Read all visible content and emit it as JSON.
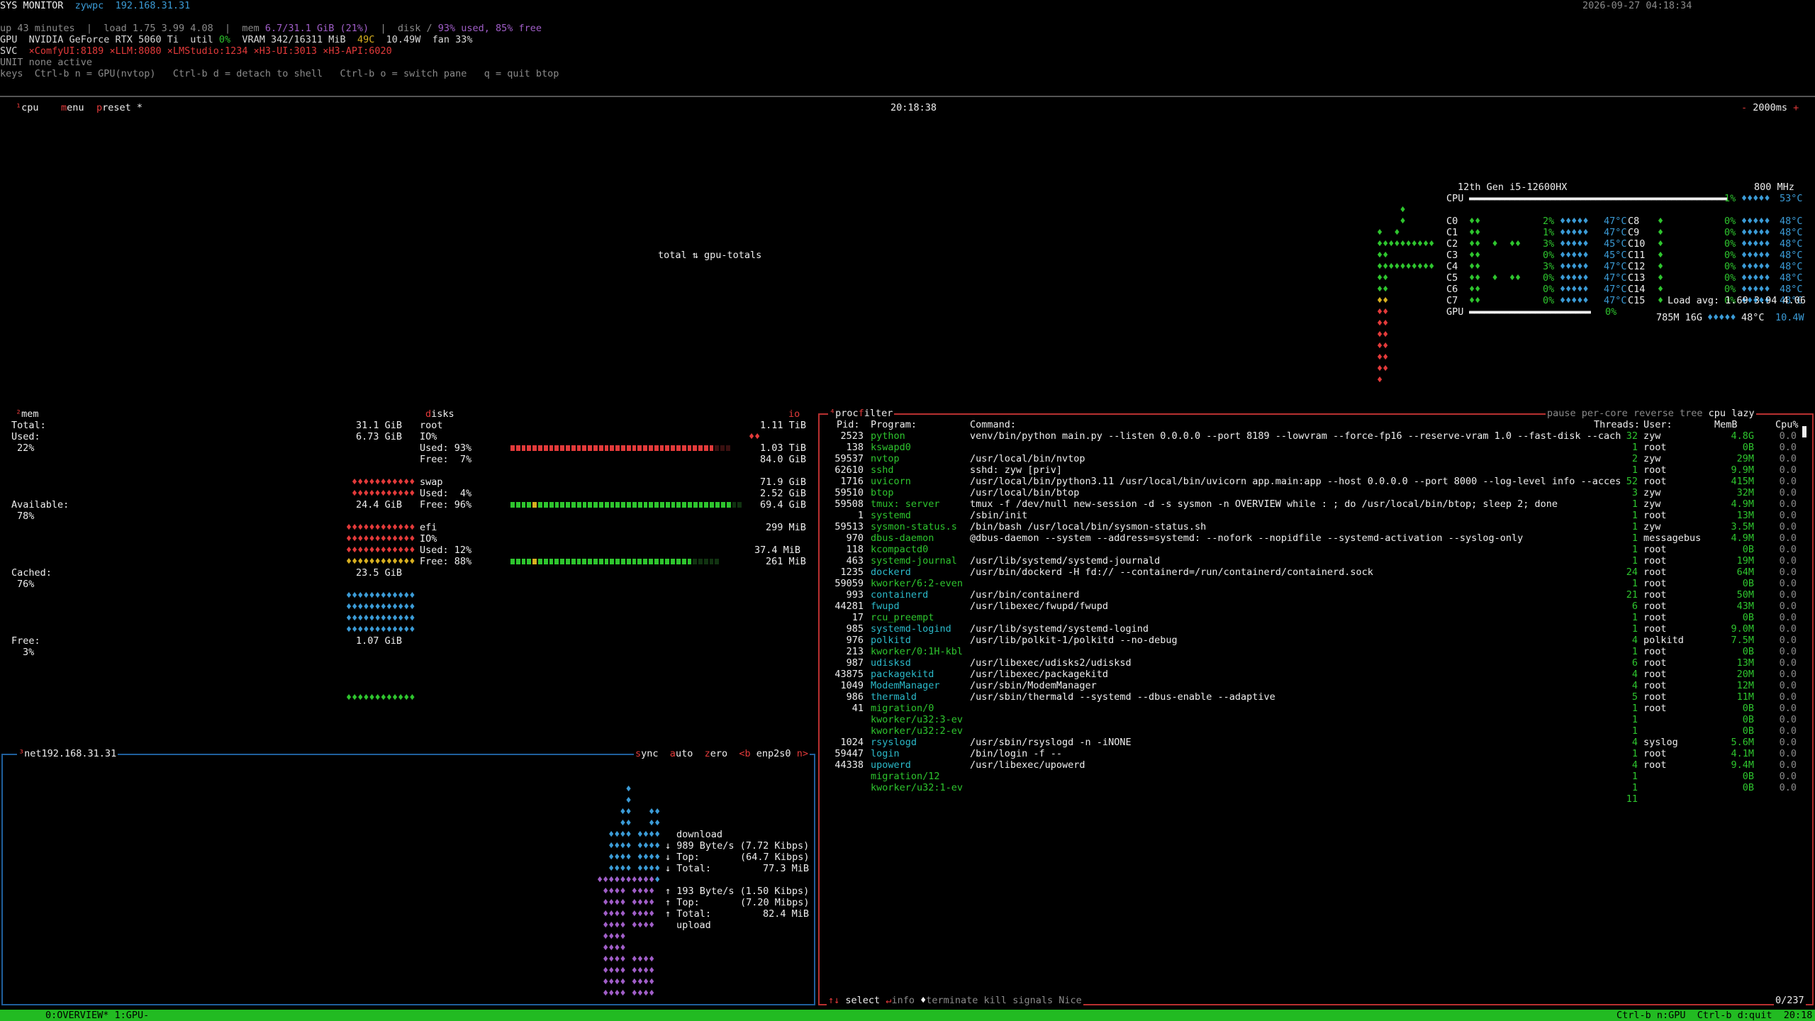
{
  "header": {
    "title": "SYS MONITOR",
    "host": "zywpc",
    "ip": "192.168.31.31",
    "datetime": "2026-09-27 04:18:34",
    "line2_a": "up 43 minutes  |  load 1.75 3.99 4.08  |  mem ",
    "line2_mem": "6.7/31.1 GiB (21%)",
    "line2_b": "  |  disk /",
    "line2_disk": " 93% used, 85% free",
    "gpu_label": "GPU  NVIDIA GeForce RTX 5060 Ti  util ",
    "gpu_util": "0%",
    "gpu_vram": "  VRAM 342/16311 MiB  ",
    "gpu_temp": "49C",
    "gpu_rest": "  10.49W  fan 33%",
    "svc_label": "SVC  ",
    "svc_items": [
      "×ComfyUI:8189 ",
      "×LLM:8080 ",
      "×LMStudio:1234 ",
      "×H3-UI:3013 ",
      "×H3-API:6020"
    ],
    "unit_line": "UNIT none active",
    "keys_line": "keys  Ctrl-b n = GPU(nvtop)   Ctrl-b d = detach to shell   Ctrl-b o = switch pane   q = quit btop"
  },
  "cpu_box": {
    "tab_num": "¹",
    "tab_label": "cpu",
    "menu_m": "m",
    "menu_label": "enu",
    "preset_p": "p",
    "preset_label": "reset *",
    "clock": "20:18:38",
    "interval_minus": "-",
    "interval": " 2000ms ",
    "interval_plus": "+",
    "graph_label": "total ⇅ gpu-totals",
    "cpu_model": "12th Gen i5-12600HX",
    "cpu_freq": "800 MHz",
    "cpu_total_label": "CPU",
    "cpu_total_pct": "1%",
    "cpu_total_temp": "53°C",
    "cores_left": [
      {
        "name": "C0",
        "pct": "2%",
        "temp": "47°C"
      },
      {
        "name": "C1",
        "pct": "1%",
        "temp": "47°C"
      },
      {
        "name": "C2",
        "pct": "3%",
        "temp": "45°C"
      },
      {
        "name": "C3",
        "pct": "0%",
        "temp": "45°C"
      },
      {
        "name": "C4",
        "pct": "3%",
        "temp": "47°C"
      },
      {
        "name": "C5",
        "pct": "0%",
        "temp": "47°C"
      },
      {
        "name": "C6",
        "pct": "0%",
        "temp": "47°C"
      },
      {
        "name": "C7",
        "pct": "0%",
        "temp": "47°C"
      }
    ],
    "cores_right": [
      {
        "name": "C8",
        "pct": "0%",
        "temp": "48°C"
      },
      {
        "name": "C9",
        "pct": "0%",
        "temp": "48°C"
      },
      {
        "name": "C10",
        "pct": "0%",
        "temp": "48°C"
      },
      {
        "name": "C11",
        "pct": "0%",
        "temp": "48°C"
      },
      {
        "name": "C12",
        "pct": "0%",
        "temp": "48°C"
      },
      {
        "name": "C13",
        "pct": "0%",
        "temp": "48°C"
      },
      {
        "name": "C14",
        "pct": "0%",
        "temp": "48°C"
      },
      {
        "name": "C15",
        "pct": "0%",
        "temp": "48°C"
      }
    ],
    "load_avg": "Load avg: 1.69 3.94 4.06",
    "gpu_label": "GPU",
    "gpu_pct": "0%",
    "gpu_mem": "785M 16G",
    "gpu_temp": "48°C",
    "gpu_watt": "10.4W"
  },
  "mem_box": {
    "tab_num": "²",
    "tab_label": "mem",
    "total_label": "Total:",
    "total_val": "31.1 GiB",
    "used_label": "Used:",
    "used_val": "6.73 GiB",
    "used_pct": "22%",
    "available_label": "Available:",
    "available_val": "24.4 GiB",
    "available_pct": "78%",
    "cached_label": "Cached:",
    "cached_val": "23.5 GiB",
    "cached_pct": "76%",
    "free_label": "Free:",
    "free_val": "1.07 GiB",
    "free_pct": "3%"
  },
  "disks": {
    "title_d": "d",
    "title_label": "isks",
    "io_label": "io",
    "root": {
      "name": "root",
      "total": "1.11 TiB",
      "io": "IO%",
      "used_label": "Used: 93%",
      "used_val": "1.03 TiB",
      "free_label": "Free:  7%",
      "free_val": "84.0 GiB",
      "used_frac": 0.93
    },
    "swap": {
      "name": "swap",
      "total": "71.9 GiB",
      "used_label": "Used:  4%",
      "used_val": "2.52 GiB",
      "free_label": "Free: 96%",
      "free_val": "69.4 GiB",
      "free_frac": 0.96
    },
    "efi": {
      "name": "efi",
      "total": "299 MiB",
      "io": "IO%",
      "used_label": "Used: 12%",
      "used_val": "37.4 MiB",
      "free_label": "Free: 88%",
      "free_val": "261 MiB",
      "free_frac": 0.88
    }
  },
  "net_box": {
    "tab_num": "³",
    "tab_label": "net",
    "ip": "192.168.31.31",
    "sync_s": "s",
    "sync_label": "ync",
    "auto_a": "a",
    "auto_label": "uto",
    "zero_z": "z",
    "zero_label": "ero",
    "iface_prev": "<b",
    "iface": " enp2s0 ",
    "iface_next": "n>",
    "download_label": "download",
    "dl_rate": "989 Byte/s (7.72 Kibps)",
    "dl_top_label": "Top:",
    "dl_top": "(64.7 Kibps)",
    "dl_total_label": "Total:",
    "dl_total": "77.3 MiB",
    "ul_rate": "193 Byte/s (1.50 Kibps)",
    "ul_top_label": "Top:",
    "ul_top": "(7.20 Mibps)",
    "ul_total_label": "Total:",
    "ul_total": "82.4 MiB",
    "upload_label": "upload"
  },
  "proc_box": {
    "tab_num": "⁴",
    "tab_label": "proc",
    "filter_f": "f",
    "filter_label": "ilter",
    "pause": "pause",
    "per_core": "per-core",
    "reverse": "reverse",
    "tree": "tree",
    "sort": "cpu lazy",
    "headers": {
      "pid": "Pid:",
      "program": "Program:",
      "command": "Command:",
      "threads": "Threads:",
      "user": "User:",
      "mem": "MemB",
      "cpu": "Cpu%"
    },
    "rows": [
      {
        "pid": "2523",
        "program": "python",
        "command": "venv/bin/python main.py --listen 0.0.0.0 --port 8189 --lowvram --force-fp16 --reserve-vram 1.0 --fast-disk --cach",
        "threads": "32",
        "user": "zyw",
        "mem": "4.8G",
        "cpu": "0.0"
      },
      {
        "pid": "138",
        "program": "kswapd0",
        "command": "",
        "threads": "1",
        "user": "root",
        "mem": "0B",
        "cpu": "0.0"
      },
      {
        "pid": "59537",
        "program": "nvtop",
        "command": "/usr/local/bin/nvtop",
        "threads": "2",
        "user": "zyw",
        "mem": "29M",
        "cpu": "0.0"
      },
      {
        "pid": "62610",
        "program": "sshd",
        "command": "sshd: zyw [priv]",
        "threads": "1",
        "user": "root",
        "mem": "9.9M",
        "cpu": "0.0"
      },
      {
        "pid": "1716",
        "program": "uvicorn",
        "command": "/usr/local/bin/python3.11 /usr/local/bin/uvicorn app.main:app --host 0.0.0.0 --port 8000 --log-level info --acces",
        "threads": "52",
        "user": "root",
        "mem": "415M",
        "cpu": "0.0"
      },
      {
        "pid": "59510",
        "program": "btop",
        "command": "/usr/local/bin/btop",
        "threads": "3",
        "user": "zyw",
        "mem": "32M",
        "cpu": "0.0"
      },
      {
        "pid": "59508",
        "program": "tmux: server",
        "command": "tmux -f /dev/null new-session -d -s sysmon -n OVERVIEW while : ; do /usr/local/bin/btop; sleep 2; done",
        "threads": "1",
        "user": "zyw",
        "mem": "4.9M",
        "cpu": "0.0"
      },
      {
        "pid": "1",
        "program": "systemd",
        "command": "/sbin/init",
        "threads": "1",
        "user": "root",
        "mem": "13M",
        "cpu": "0.0"
      },
      {
        "pid": "59513",
        "program": "sysmon-status.s",
        "command": "/bin/bash /usr/local/bin/sysmon-status.sh",
        "threads": "1",
        "user": "zyw",
        "mem": "3.5M",
        "cpu": "0.0"
      },
      {
        "pid": "970",
        "program": "dbus-daemon",
        "command": "@dbus-daemon --system --address=systemd: --nofork --nopidfile --systemd-activation --syslog-only",
        "threads": "1",
        "user": "messagebus",
        "mem": "4.9M",
        "cpu": "0.0"
      },
      {
        "pid": "118",
        "program": "kcompactd0",
        "command": "",
        "threads": "1",
        "user": "root",
        "mem": "0B",
        "cpu": "0.0"
      },
      {
        "pid": "463",
        "program": "systemd-journal",
        "command": "/usr/lib/systemd/systemd-journald",
        "threads": "1",
        "user": "root",
        "mem": "19M",
        "cpu": "0.0"
      },
      {
        "pid": "1235",
        "program": "dockerd",
        "command": "/usr/bin/dockerd -H fd:// --containerd=/run/containerd/containerd.sock",
        "threads": "24",
        "user": "root",
        "mem": "64M",
        "cpu": "0.0"
      },
      {
        "pid": "59059",
        "program": "kworker/6:2-even",
        "command": "",
        "threads": "1",
        "user": "root",
        "mem": "0B",
        "cpu": "0.0"
      },
      {
        "pid": "993",
        "program": "containerd",
        "command": "/usr/bin/containerd",
        "threads": "21",
        "user": "root",
        "mem": "50M",
        "cpu": "0.0"
      },
      {
        "pid": "44281",
        "program": "fwupd",
        "command": "/usr/libexec/fwupd/fwupd",
        "threads": "6",
        "user": "root",
        "mem": "43M",
        "cpu": "0.0"
      },
      {
        "pid": "17",
        "program": "rcu_preempt",
        "command": "",
        "threads": "1",
        "user": "root",
        "mem": "0B",
        "cpu": "0.0"
      },
      {
        "pid": "985",
        "program": "systemd-logind",
        "command": "/usr/lib/systemd/systemd-logind",
        "threads": "1",
        "user": "root",
        "mem": "9.0M",
        "cpu": "0.0"
      },
      {
        "pid": "976",
        "program": "polkitd",
        "command": "/usr/lib/polkit-1/polkitd --no-debug",
        "threads": "4",
        "user": "polkitd",
        "mem": "7.5M",
        "cpu": "0.0"
      },
      {
        "pid": "213",
        "program": "kworker/0:1H-kbl",
        "command": "",
        "threads": "1",
        "user": "root",
        "mem": "0B",
        "cpu": "0.0"
      },
      {
        "pid": "987",
        "program": "udisksd",
        "command": "/usr/libexec/udisks2/udisksd",
        "threads": "6",
        "user": "root",
        "mem": "13M",
        "cpu": "0.0"
      },
      {
        "pid": "43875",
        "program": "packagekitd",
        "command": "/usr/libexec/packagekitd",
        "threads": "4",
        "user": "root",
        "mem": "20M",
        "cpu": "0.0"
      },
      {
        "pid": "1049",
        "program": "ModemManager",
        "command": "/usr/sbin/ModemManager",
        "threads": "4",
        "user": "root",
        "mem": "12M",
        "cpu": "0.0"
      },
      {
        "pid": "986",
        "program": "thermald",
        "command": "/usr/sbin/thermald --systemd --dbus-enable --adaptive",
        "threads": "5",
        "user": "root",
        "mem": "11M",
        "cpu": "0.0"
      },
      {
        "pid": "41",
        "program": "migration/0",
        "command": "",
        "threads": "1",
        "user": "root",
        "mem": "0B",
        "cpu": "0.0"
      },
      {
        "pid": "",
        "program": "kworker/u32:3-ev",
        "command": "",
        "threads": "1",
        "user": "",
        "mem": "0B",
        "cpu": "0.0"
      },
      {
        "pid": "",
        "program": "kworker/u32:2-ev",
        "command": "",
        "threads": "1",
        "user": "",
        "mem": "0B",
        "cpu": "0.0"
      },
      {
        "pid": "1024",
        "program": "rsyslogd",
        "command": "/usr/sbin/rsyslogd -n -iNONE",
        "threads": "4",
        "user": "syslog",
        "mem": "5.6M",
        "cpu": "0.0"
      },
      {
        "pid": "59447",
        "program": "login",
        "command": "/bin/login -f --",
        "threads": "1",
        "user": "root",
        "mem": "4.1M",
        "cpu": "0.0"
      },
      {
        "pid": "44338",
        "program": "upowerd",
        "command": "/usr/libexec/upowerd",
        "threads": "4",
        "user": "root",
        "mem": "9.4M",
        "cpu": "0.0"
      },
      {
        "pid": "",
        "program": "migration/12",
        "command": "",
        "threads": "1",
        "user": "",
        "mem": "0B",
        "cpu": "0.0"
      },
      {
        "pid": "",
        "program": "kworker/u32:1-ev",
        "command": "",
        "threads": "1",
        "user": "",
        "mem": "0B",
        "cpu": "0.0"
      },
      {
        "pid": "",
        "program": "",
        "command": "",
        "threads": "11",
        "user": "",
        "mem": "",
        "cpu": ""
      }
    ],
    "footer_select": "select",
    "footer_info": "info",
    "footer_terminate": "terminate",
    "footer_kill": "kill",
    "footer_signals": "signals",
    "footer_nice": "Nice",
    "count": "0/237"
  },
  "statusbar": {
    "windows": "0:OVERVIEW* 1:GPU-",
    "right": "Ctrl-b n:GPU  Ctrl-b d:quit  20:18"
  },
  "colors": {
    "accent_green": "#2ec52e",
    "accent_blue": "#3b9bd6",
    "accent_red": "#e23a3a",
    "box_red": "#b83030",
    "box_blue": "#1f5f9c",
    "status_bg": "#22bb22"
  }
}
